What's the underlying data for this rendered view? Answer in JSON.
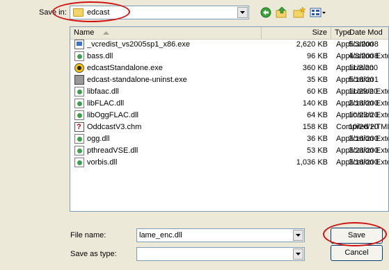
{
  "save_in": {
    "label": "Save in:",
    "value": "edcast"
  },
  "columns": {
    "name": "Name",
    "size": "Size",
    "type": "Type",
    "date": "Date Mod"
  },
  "files": [
    {
      "name": "_vcredist_vs2005sp1_x86.exe",
      "size": "2,620 KB",
      "type": "Application",
      "date": "5/3/2008",
      "icon": "installer-icon"
    },
    {
      "name": "bass.dll",
      "size": "96 KB",
      "type": "Application Extension",
      "date": "4/8/2008",
      "icon": "dll-icon"
    },
    {
      "name": "edcastStandalone.exe",
      "size": "360 KB",
      "type": "Application",
      "date": "11/3/200",
      "icon": "app-icon"
    },
    {
      "name": "edcast-standalone-uninst.exe",
      "size": "35 KB",
      "type": "Application",
      "date": "5/18/201",
      "icon": "uninstaller-icon"
    },
    {
      "name": "libfaac.dll",
      "size": "60 KB",
      "type": "Application Extension",
      "date": "11/29/20",
      "icon": "dll-icon"
    },
    {
      "name": "libFLAC.dll",
      "size": "140 KB",
      "type": "Application Extension",
      "date": "2/13/200",
      "icon": "dll-icon"
    },
    {
      "name": "libOggFLAC.dll",
      "size": "64 KB",
      "type": "Application Extension",
      "date": "10/23/20",
      "icon": "dll-icon"
    },
    {
      "name": "OddcastV3.chm",
      "size": "158 KB",
      "type": "Compiled HTML Help...",
      "date": "10/26/20",
      "icon": "help-file-icon"
    },
    {
      "name": "ogg.dll",
      "size": "36 KB",
      "type": "Application Extension",
      "date": "3/16/200",
      "icon": "dll-icon"
    },
    {
      "name": "pthreadVSE.dll",
      "size": "53 KB",
      "type": "Application Extension",
      "date": "3/23/200",
      "icon": "dll-icon"
    },
    {
      "name": "vorbis.dll",
      "size": "1,036 KB",
      "type": "Application Extension",
      "date": "3/16/200",
      "icon": "dll-icon"
    }
  ],
  "file_name": {
    "label": "File name:",
    "value": "lame_enc.dll"
  },
  "save_as_type": {
    "label": "Save as type:",
    "value": ""
  },
  "buttons": {
    "save": "Save",
    "cancel": "Cancel"
  },
  "colors": {
    "highlight": "#d01010",
    "field_border": "#7f9db9",
    "dialog_bg": "#ece9d8"
  }
}
